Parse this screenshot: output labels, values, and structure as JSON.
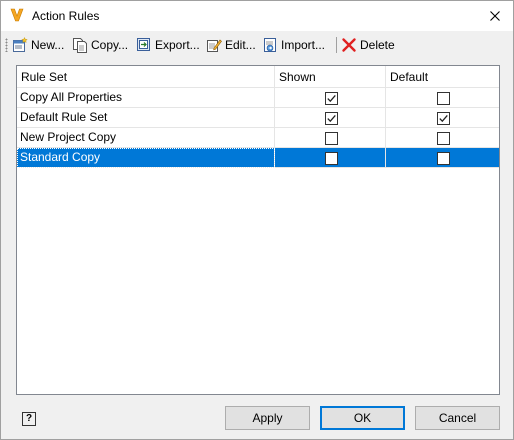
{
  "window": {
    "title": "Action Rules",
    "app_icon": "vault-v-logo",
    "close": "close-icon"
  },
  "toolbar": {
    "new_label": "New...",
    "copy_label": "Copy...",
    "export_label": "Export...",
    "edit_label": "Edit...",
    "import_label": "Import...",
    "delete_label": "Delete"
  },
  "table": {
    "columns": [
      "Rule Set",
      "Shown",
      "Default"
    ],
    "rows": [
      {
        "name": "Copy All Properties",
        "shown": true,
        "default": false,
        "selected": false
      },
      {
        "name": "Default Rule Set",
        "shown": true,
        "default": true,
        "selected": false
      },
      {
        "name": "New Project Copy",
        "shown": false,
        "default": false,
        "selected": false
      },
      {
        "name": "Standard Copy",
        "shown": false,
        "default": false,
        "selected": true
      }
    ]
  },
  "footer": {
    "help_label": "?",
    "apply_label": "Apply",
    "ok_label": "OK",
    "cancel_label": "Cancel"
  },
  "colors": {
    "selection": "#0078d7",
    "vault_logo": "#f5a623",
    "delete_x": "#e02020"
  }
}
